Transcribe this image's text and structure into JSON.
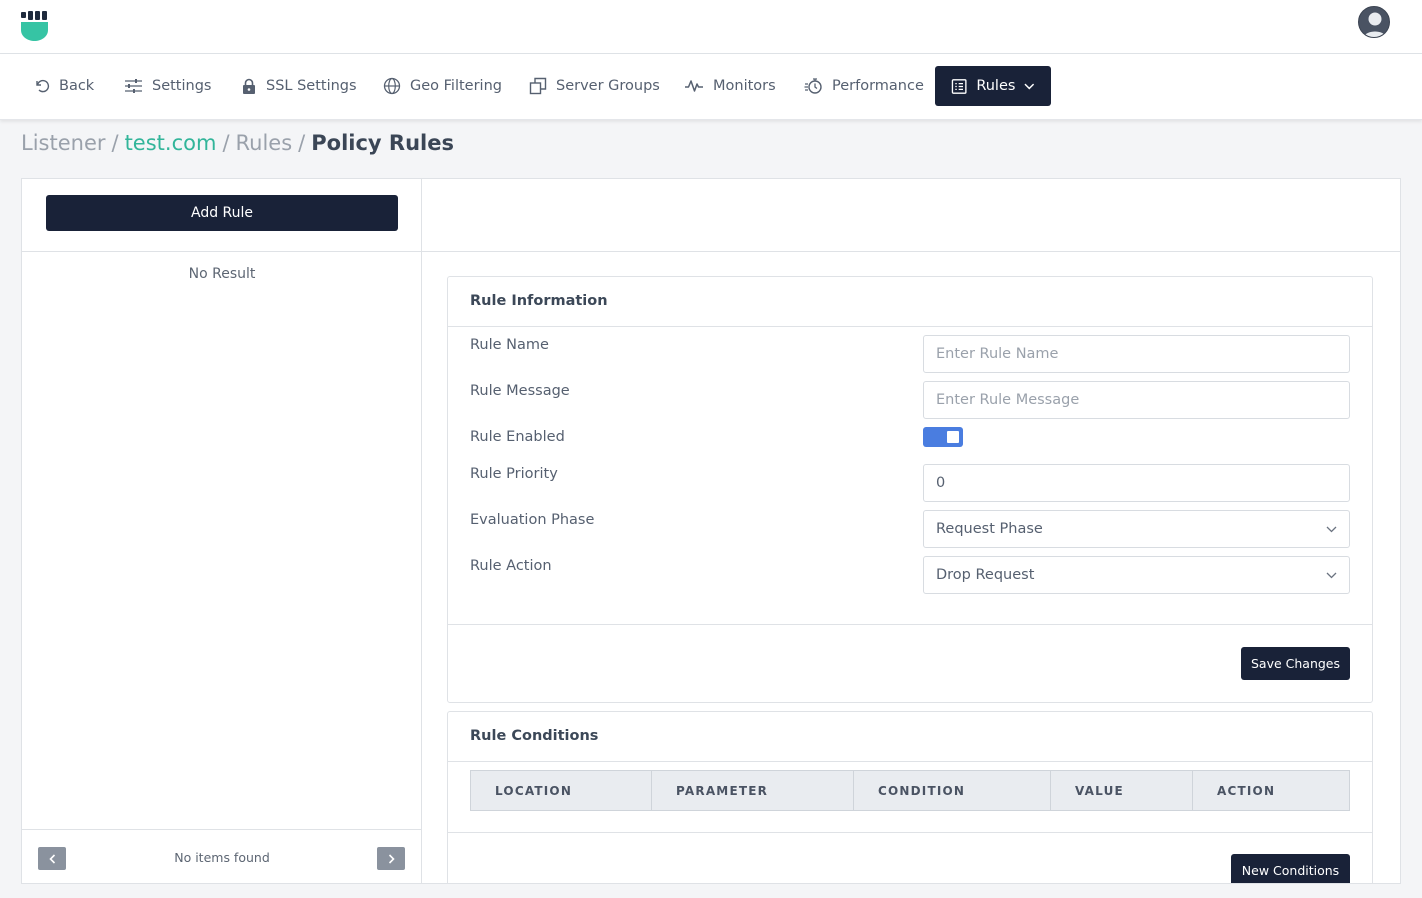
{
  "nav": {
    "items": [
      {
        "label": "Back",
        "icon": "undo-icon"
      },
      {
        "label": "Settings",
        "icon": "sliders-icon"
      },
      {
        "label": "SSL Settings",
        "icon": "lock-icon"
      },
      {
        "label": "Geo Filtering",
        "icon": "globe-icon"
      },
      {
        "label": "Server Groups",
        "icon": "copy-icon"
      },
      {
        "label": "Monitors",
        "icon": "activity-icon"
      },
      {
        "label": "Performance",
        "icon": "stopwatch-icon"
      },
      {
        "label": "Rules",
        "icon": "list-icon",
        "active": true
      }
    ]
  },
  "breadcrumb": {
    "items": [
      "Listener",
      "test.com",
      "Rules"
    ],
    "current": "Policy Rules",
    "separator": "/"
  },
  "left_panel": {
    "add_rule_label": "Add Rule",
    "empty_text": "No Result",
    "pagination_text": "No items found"
  },
  "rule_info": {
    "title": "Rule Information",
    "fields": {
      "name_label": "Rule Name",
      "name_placeholder": "Enter Rule Name",
      "message_label": "Rule Message",
      "message_placeholder": "Enter Rule Message",
      "enabled_label": "Rule Enabled",
      "enabled": true,
      "priority_label": "Rule Priority",
      "priority_value": "0",
      "phase_label": "Evaluation Phase",
      "phase_value": "Request Phase",
      "action_label": "Rule Action",
      "action_value": "Drop Request"
    },
    "save_label": "Save Changes"
  },
  "conditions": {
    "title": "Rule Conditions",
    "columns": [
      "LOCATION",
      "PARAMETER",
      "CONDITION",
      "VALUE",
      "ACTION"
    ],
    "new_label": "New Conditions"
  },
  "colors": {
    "primary_dark": "#192238",
    "accent_green": "#32b59a",
    "toggle_blue": "#4a7de0"
  }
}
